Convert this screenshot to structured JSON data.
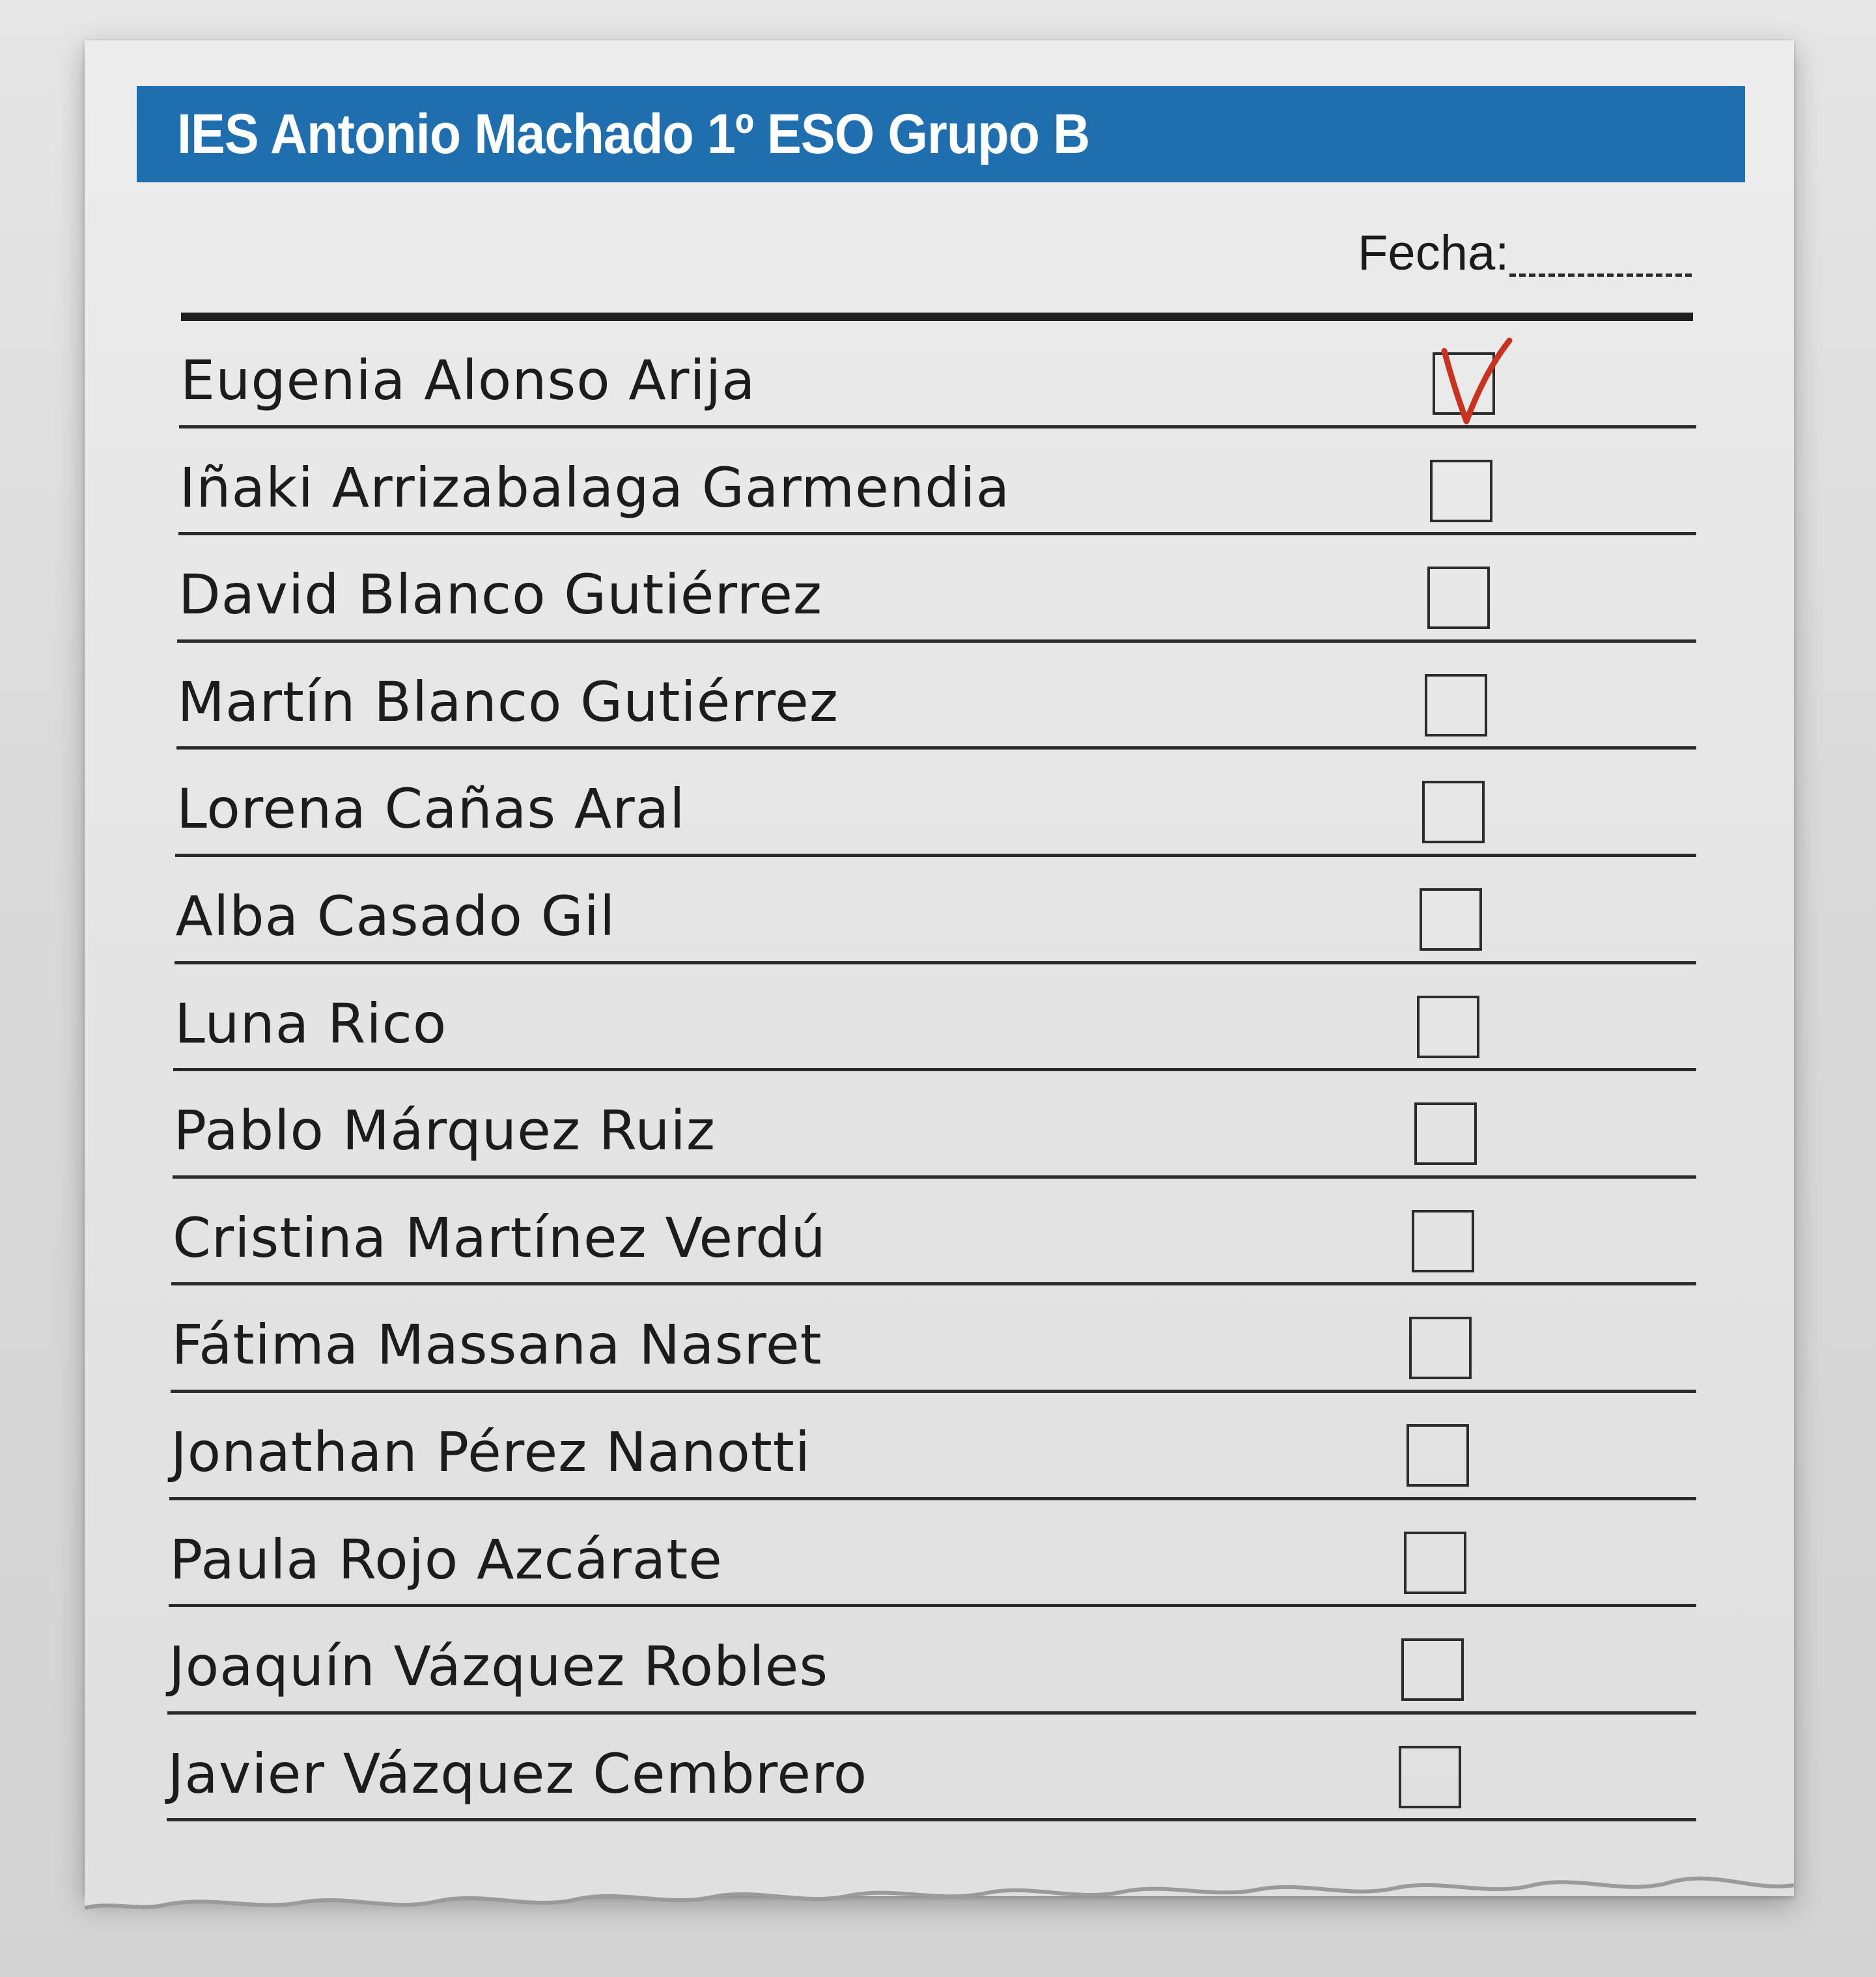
{
  "header": {
    "title": "IES Antonio Machado 1º ESO Grupo B"
  },
  "date_field": {
    "label": "Fecha:"
  },
  "students": [
    {
      "name": "Eugenia Alonso Arija",
      "checked": true
    },
    {
      "name": "Iñaki Arrizabalaga Garmendia",
      "checked": false
    },
    {
      "name": "David Blanco Gutiérrez",
      "checked": false
    },
    {
      "name": "Martín Blanco Gutiérrez",
      "checked": false
    },
    {
      "name": "Lorena Cañas Aral",
      "checked": false
    },
    {
      "name": "Alba Casado Gil",
      "checked": false
    },
    {
      "name": "Luna Rico",
      "checked": false
    },
    {
      "name": "Pablo Márquez Ruiz",
      "checked": false
    },
    {
      "name": "Cristina Martínez Verdú",
      "checked": false
    },
    {
      "name": "Fátima Massana Nasret",
      "checked": false
    },
    {
      "name": "Jonathan Pérez Nanotti",
      "checked": false
    },
    {
      "name": "Paula Rojo Azcárate",
      "checked": false
    },
    {
      "name": "Joaquín Vázquez Robles",
      "checked": false
    },
    {
      "name": "Javier Vázquez Cembrero",
      "checked": false
    }
  ],
  "colors": {
    "header_band": "#1f6eb0",
    "check_mark": "#c8321e"
  }
}
